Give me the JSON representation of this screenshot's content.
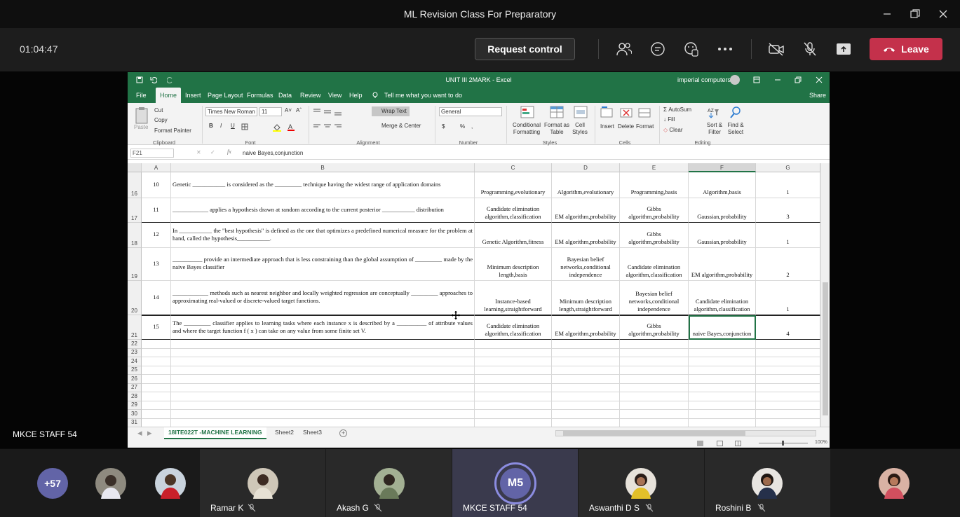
{
  "window": {
    "title": "ML Revision Class For Preparatory"
  },
  "call": {
    "timer": "01:04:47",
    "request_control": "Request control",
    "leave": "Leave",
    "presenter": "MKCE STAFF 54"
  },
  "excel": {
    "title": "UNIT III  2MARK  -  Excel",
    "user": "imperial computers",
    "tabs": [
      "File",
      "Home",
      "Insert",
      "Page Layout",
      "Formulas",
      "Data",
      "Review",
      "View",
      "Help"
    ],
    "tell_me": "Tell me what you want to do",
    "share": "Share",
    "clipboard": {
      "paste": "Paste",
      "cut": "Cut",
      "copy": "Copy",
      "format_painter": "Format Painter",
      "group": "Clipboard"
    },
    "font": {
      "name": "Times New Roman",
      "size": "11",
      "group": "Font"
    },
    "alignment": {
      "wrap": "Wrap Text",
      "merge": "Merge & Center",
      "group": "Alignment"
    },
    "number": {
      "format": "General",
      "group": "Number"
    },
    "styles": {
      "conditional": "Conditional Formatting",
      "format_table": "Format as Table",
      "cell_styles": "Cell Styles",
      "group": "Styles"
    },
    "cells": {
      "insert": "Insert",
      "delete": "Delete",
      "format": "Format",
      "group": "Cells"
    },
    "editing": {
      "autosum": "AutoSum",
      "fill": "Fill",
      "clear": "Clear",
      "sort": "Sort & Filter",
      "find": "Find & Select",
      "group": "Editing"
    },
    "name_box": "F21",
    "formula": "naive Bayes,conjunction",
    "columns": [
      "A",
      "B",
      "C",
      "D",
      "E",
      "F",
      "G"
    ],
    "rows": [
      {
        "rownum": "16",
        "a": "10",
        "b": "Genetic ___________ is considered as the _________ technique having the widest range of application domains",
        "c": "Programming,evolutionary",
        "d": "Algorithm,evolutionary",
        "e": "Programming,basis",
        "f": "Algorithm,basis",
        "g": "1"
      },
      {
        "rownum": "17",
        "a": "11",
        "b": "____________ applies a hypothesis drawn at random according to the current posterior ___________ distribution",
        "c": "Candidate elimination algorithm,classification",
        "d": "EM algorithm,probability",
        "e": "Gibbs algorithm,probability",
        "f": "Gaussian,probability",
        "g": "3"
      },
      {
        "rownum": "18",
        "a": "12",
        "b": "In ___________ the \"best hypothesis\" is defined as the one that optimizes a predefined numerical measure for the problem at hand, called the hypothesis___________.",
        "c": "Genetic Algorithm,fitness",
        "d": "EM algorithm,probability",
        "e": "Gibbs algorithm,probability",
        "f": "Gaussian,probability",
        "g": "1"
      },
      {
        "rownum": "19",
        "a": "13",
        "b": "__________ provide an intermediate approach that is less constraining than the global assumption of _________ made by the naive Bayes classifier",
        "c": "Minimum description length,basis",
        "d": "Bayesian belief networks,conditional independence",
        "e": "Candidate elimination algorithm,classification",
        "f": "EM algorithm,probability",
        "g": "2"
      },
      {
        "rownum": "20",
        "a": "14",
        "b": "____________ methods such as nearest neighbor and locally weighted regression are conceptually _________ approaches to approximating real-valued or discrete-valued target functions.",
        "c": "Instance-based learning,straightforward",
        "d": "Minimum description length,straightforward",
        "e": "Bayesian belief networks,conditional independence",
        "f": "Candidate elimination algorithm,classification",
        "g": "1"
      },
      {
        "rownum": "21",
        "a": "15",
        "b": "The _________ classifier applies to learning tasks where each instance x is described by a __________ of attribute values and where the target function f ( x ) can take on any value from some finite set V.",
        "c": "Candidate elimination algorithm,classification",
        "d": "EM algorithm,probability",
        "e": "Gibbs algorithm,probability",
        "f": "naive Bayes,conjunction",
        "g": "4"
      }
    ],
    "empty_rows": [
      "22",
      "23",
      "24",
      "25",
      "26",
      "27",
      "28",
      "29",
      "30",
      "31"
    ],
    "sheets": [
      "18ITE022T -MACHINE LEARNING",
      "Sheet2",
      "Sheet3"
    ],
    "zoom": "100%"
  },
  "participants": {
    "overflow": "+57",
    "tiles": [
      {
        "name": ""
      },
      {
        "name": ""
      },
      {
        "name": "Ramar K"
      },
      {
        "name": "Akash G"
      },
      {
        "name": "MKCE STAFF 54",
        "initials": "M5"
      },
      {
        "name": "Aswanthi D S"
      },
      {
        "name": "Roshini B"
      },
      {
        "name": ""
      }
    ]
  },
  "colors": {
    "excel_green": "#217346",
    "leave_red": "#c4314b",
    "avatar_purple": "#6264a7"
  }
}
